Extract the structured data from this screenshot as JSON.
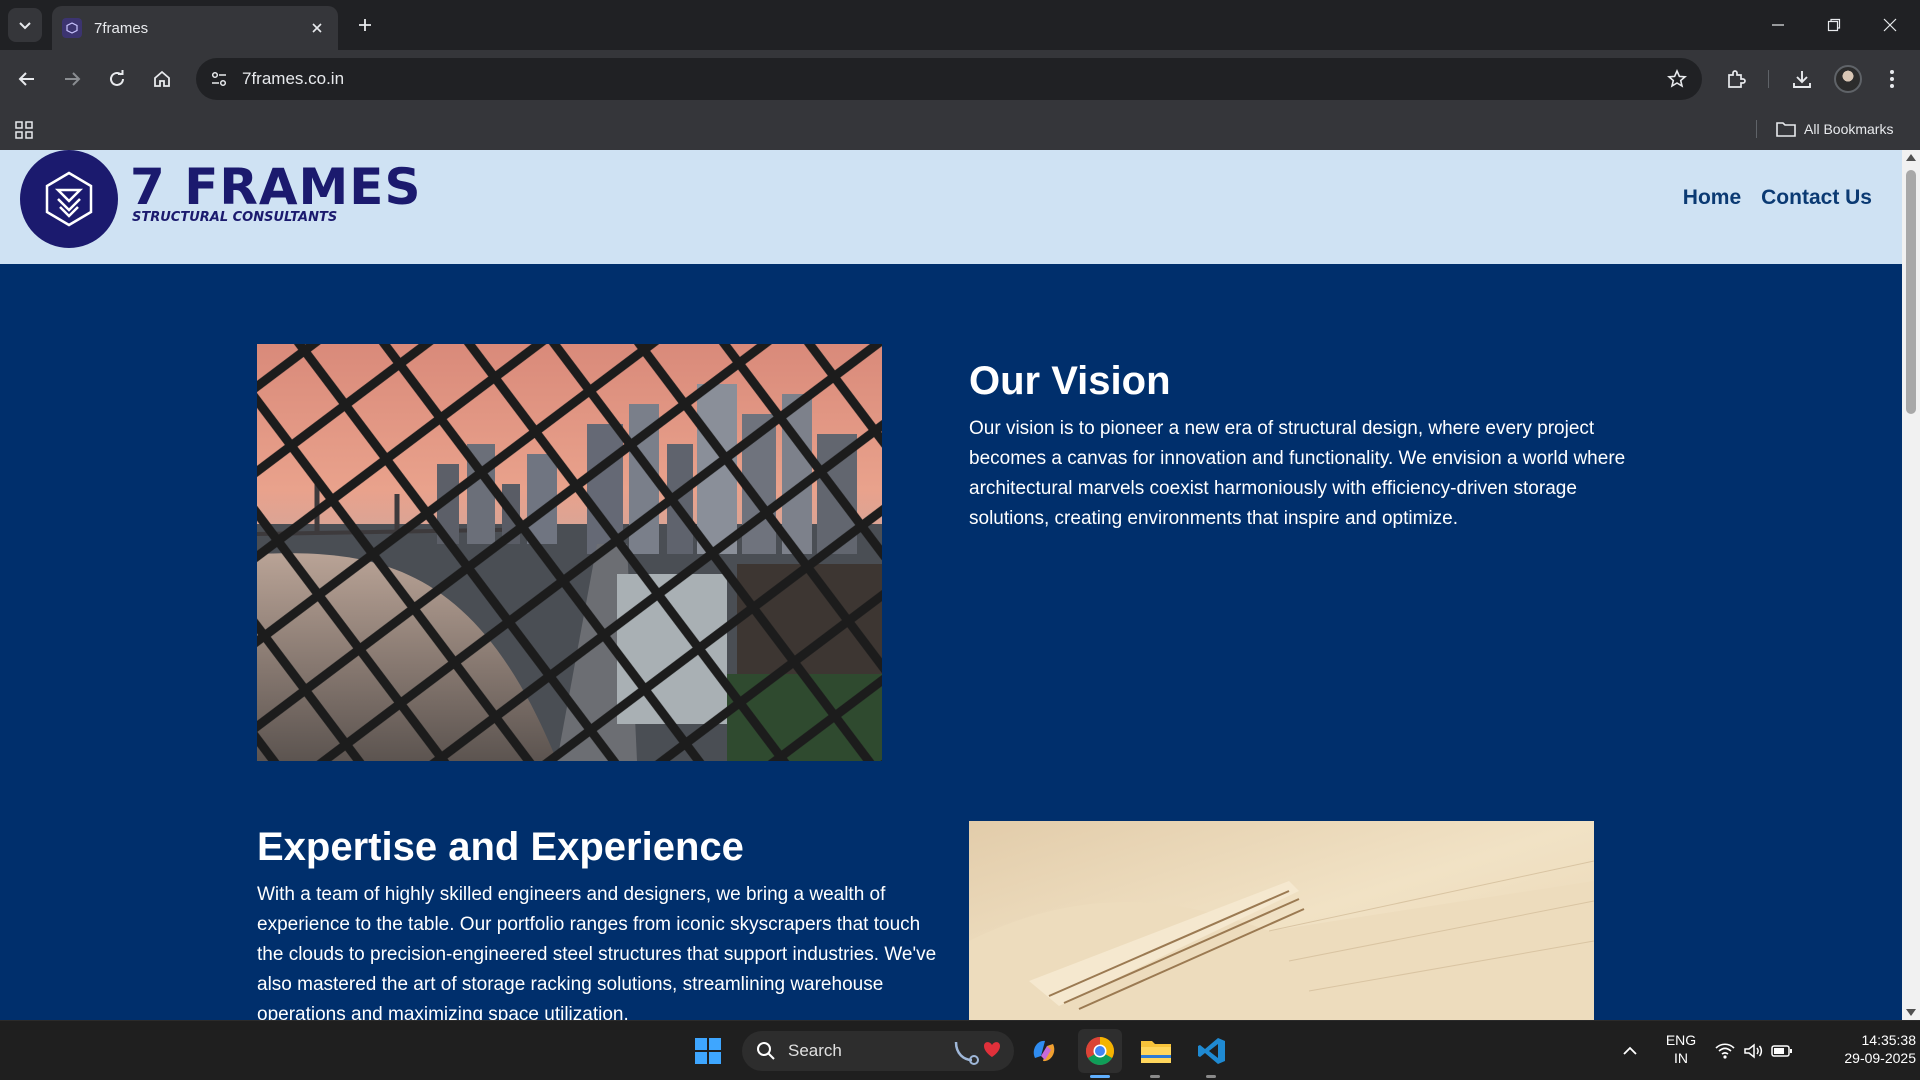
{
  "browser": {
    "tab_title": "7frames",
    "url": "7frames.co.in",
    "bookmarks_label": "All Bookmarks"
  },
  "site": {
    "brand_name": "7 FRAMES",
    "brand_tagline": "STRUCTURAL CONSULTANTS",
    "nav": {
      "home": "Home",
      "contact": "Contact Us"
    },
    "vision": {
      "heading": "Our Vision",
      "text": "Our vision is to pioneer a new era of structural design, where every project becomes a canvas for innovation and functionality. We envision a world where architectural marvels coexist harmoniously with efficiency-driven storage solutions, creating environments that inspire and optimize."
    },
    "expertise": {
      "heading": "Expertise and Experience",
      "text": "With a team of highly skilled engineers and designers, we bring a wealth of experience to the table. Our portfolio ranges from iconic skyscrapers that touch the clouds to precision-engineered steel structures that support industries. We've also mastered the art of storage racking solutions, streamlining warehouse operations and maximizing space utilization."
    }
  },
  "taskbar": {
    "search_placeholder": "Search",
    "lang_line1": "ENG",
    "lang_line2": "IN",
    "time": "14:35:38",
    "date": "29-09-2025"
  },
  "colors": {
    "page_bg": "#002f6c",
    "header_bg": "#cfe2f3",
    "brand": "#1b1a6e",
    "nav_link": "#0b3a73"
  }
}
